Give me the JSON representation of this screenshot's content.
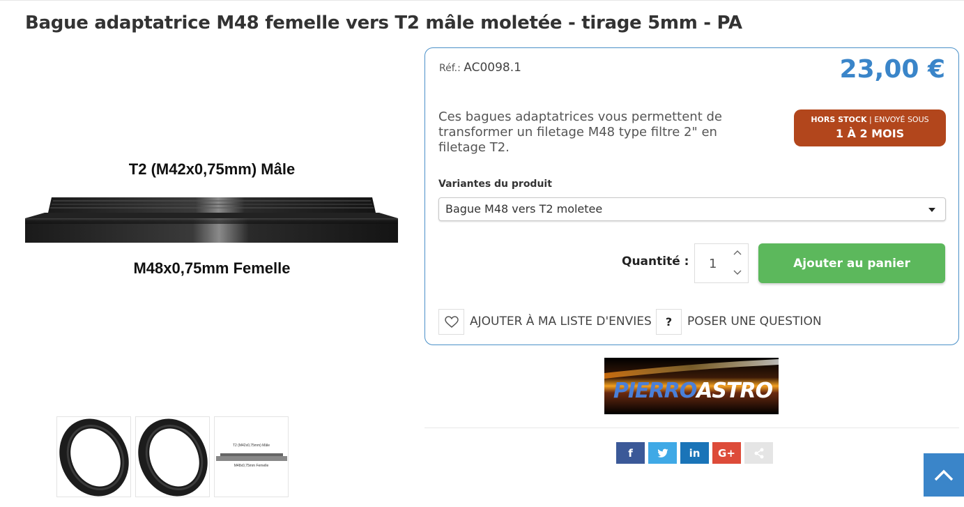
{
  "page_title": "Bague adaptatrice M48 femelle vers T2 mâle moletée - tirage 5mm - PA",
  "main_image": {
    "label_top": "T2 (M42x0,75mm) Mâle",
    "label_bottom": "M48x0,75mm Femelle"
  },
  "thumbnails": [
    {
      "icon": "ring-photo"
    },
    {
      "icon": "ring-photo"
    },
    {
      "label_top": "T2 (M42x0,75mm) Mâle",
      "label_bottom": "M48x0,75mm Femelle"
    }
  ],
  "product": {
    "ref_label": "Réf.:",
    "ref_value": "AC0098.1",
    "price": "23,00 €",
    "description": "Ces bagues adaptatrices vous permettent de transformer un filetage M48 type filtre 2\" en filetage T2.",
    "stock": {
      "status": "HORS STOCK",
      "separator": "|",
      "shipping": "ENVOYÉ SOUS",
      "delay": "1 À 2 MOIS",
      "color": "#b2461c"
    },
    "variants_label": "Variantes du produit",
    "variant_selected": "Bague M48 vers T2 moletee",
    "quantity_label": "Quantité :",
    "quantity_value": "1",
    "add_to_cart_label": "Ajouter au panier",
    "wishlist_label": "AJOUTER À MA LISTE D'ENVIES",
    "question_icon_text": "?",
    "question_label": "POSER UNE QUESTION"
  },
  "logo": {
    "part1": "PIERRO",
    "part2": "ASTRO"
  },
  "share": {
    "facebook": "f",
    "twitter_icon": "twitter-icon",
    "linkedin": "in",
    "googleplus": "G+",
    "more_icon": "share-icon"
  },
  "colors": {
    "price": "#3a85c9",
    "add_to_cart": "#5cb85c",
    "box_border": "#4a90c8"
  }
}
